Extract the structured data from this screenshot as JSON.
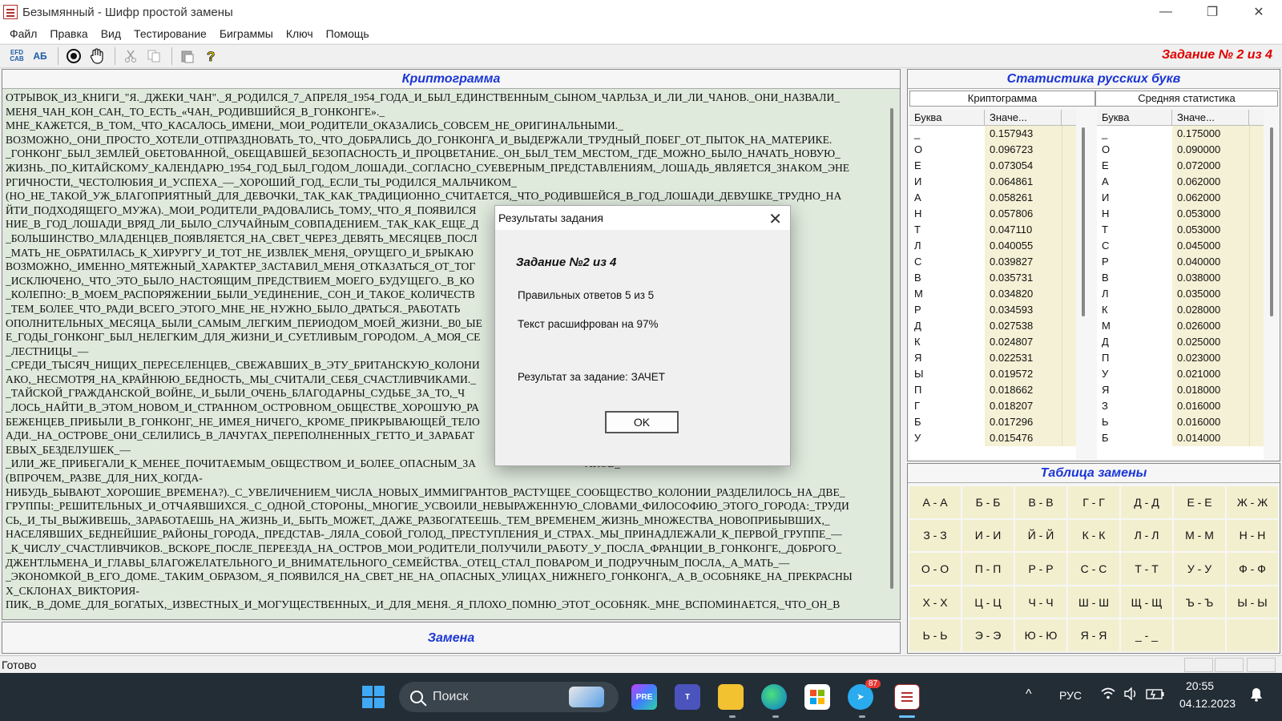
{
  "window": {
    "title": "Безымянный - Шифр простой замены",
    "controls": [
      "—",
      "❐",
      "✕"
    ]
  },
  "menu": [
    "Файл",
    "Правка",
    "Вид",
    "Тестирование",
    "Биграммы",
    "Ключ",
    "Помощь"
  ],
  "toolbar": {
    "buttons": [
      "EFD CAB",
      "АБ"
    ],
    "task_label": "Задание № 2 из 4"
  },
  "cryptogram": {
    "title": "Криптограмма",
    "lines": [
      "ОТРЫВОК_ИЗ_КНИГИ_\"Я._ДЖЕКИ_ЧАН\"._Я_РОДИЛСЯ_7_АПРЕЛЯ_1954_ГОДА_И_БЫЛ_ЕДИНСТВЕННЫМ_СЫНОМ_ЧАРЛЬЗА_И_ЛИ_ЛИ_ЧАНОВ._ОНИ_НАЗВАЛИ_",
      "МЕНЯ_ЧАН_КОН_САН,_ТО_ЕСТЬ_«ЧАН,_РОДИВШИЙСЯ_В_ГОНКОНГЕ»._",
      "МНЕ_КАЖЕТСЯ,_В_ТОМ,_ЧТО_КАСАЛОСЬ_ИМЕНИ,_МОИ_РОДИТЕЛИ_ОКАЗАЛИСЬ_СОВСЕМ_НЕ_ОРИГИНАЛЬНЫМИ._",
      "ВОЗМОЖНО,_ОНИ_ПРОСТО_ХОТЕЛИ_ОТПРАЗДНОВАТЬ_ТО,_ЧТО_ДОБРАЛИСЬ_ДО_ГОНКОНГА_И_ВЫДЕРЖАЛИ_ТРУДНЫЙ_ПОБЕГ_ОТ_ПЫТОК_НА_МАТЕРИКЕ.",
      "_ГОНКОНГ_БЫЛ_ЗЕМЛЕЙ_ОБЕТОВАННОЙ,_ОБЕЩАВШЕЙ_БЕЗОПАСНОСТЬ_И_ПРОЦВЕТАНИЕ._ОН_БЫЛ_ТЕМ_МЕСТОМ,_ГДЕ_МОЖНО_БЫЛО_НАЧАТЬ_НОВУЮ_",
      "ЖИЗНЬ._ПО_КИТАЙСКОМУ_КАЛЕНДАРЮ_1954_ГОД_БЫЛ_ГОДОМ_ЛОШАДИ._СОГЛАСНО_СУЕВЕРНЫМ_ПРЕДСТАВЛЕНИЯМ,_ЛОШАДЬ_ЯВЛЯЕТСЯ_ЗНАКОМ_ЭНЕ",
      "РГИЧНОСТИ,_ЧЕСТОЛЮБИЯ_И_УСПЕХА_—_ХОРОШИЙ_ГОД,_ЕСЛИ_ТЫ_РОДИЛСЯ_МАЛЬЧИКОМ_",
      "(НО_НЕ_ТАКОЙ_УЖ_БЛАГОПРИЯТНЫЙ_ДЛЯ_ДЕВОЧКИ,_ТАК_КАК_ТРАДИЦИОННО_СЧИТАЕТСЯ,_ЧТО_РОДИВШЕЙСЯ_В_ГОД_ЛОШАДИ_ДЕВУШКЕ_ТРУДНО_НА",
      "ЙТИ_ПОДХОДЯЩЕГО_МУЖА)._МОИ_РОДИТЕЛИ_РАДОВАЛИСЬ_ТОМУ,_ЧТО_Я_ПОЯВИЛСЯ                                           СТВЕННЫ._РОЖДЕ",
      "НИЕ_В_ГОД_ЛОШАДИ_ВРЯД_ЛИ_БЫЛО_СЛУЧАЙНЫМ_СОВПАДЕНИЕМ._ТАК_КАК_ЕЩЕ_Д                                                 РЯМЫМ!",
      "_БОЛЬШИНСТВО_МЛАДЕНЦЕВ_ПОЯВЛЯЕТСЯ_НА_СВЕТ_ЧЕРЕЗ_ДЕВЯТЬ_МЕСЯЦЕВ_ПОСЛ                                           ДОЛЬШЕ,_ПОКА",
      "_МАТЬ_НЕ_ОБРАТИЛАСЬ_К_ХИРУРГУ_И_ТОТ_НЕ_ИЗВЛЕК_МЕНЯ,_ОРУЩЕГО_И_БРЫКАЮ                                              ",
      "ВОЗМОЖНО,_ИМЕННО_МЯТЕЖНЫЙ_ХАРАКТЕР_ЗАСТАВИЛ_МЕНЯ_ОТКАЗАТЬСЯ_ОТ_ТОГ                                           ЛЯМ,_ХОТЯ_НЕ",
      "_ИСКЛЮЧЕНО,_ЧТО_ЭТО_БЫЛО_НАСТОЯЩИМ_ПРЕДСТВИЕМ_МОЕГО_БУДУЩЕГО._В_КО                                          СЕБЯ_ВЕЛИ-",
      "_КОЛЕПНО:_В_МОЕМ_РАСПОРЯЖЕНИИ_БЫЛИ_УЕДИНЕНИЕ,_СОН_И_ТАКОЕ_КОЛИЧЕСТВ                                          Я._—",
      "_ТЕМ_БОЛЕЕ_ЧТО_РАДИ_ВСЕГО_ЭТОГО_МНЕ_НЕ_НУЖНО_БЫЛО_ДРАТЬСЯ._РАБОТАТЬ                                          ЧТО_ТЕ_ТРИ_Д",
      "ОПОЛНИТЕЛЬНЫХ_МЕСЯЦА_БЫЛИ_САМЫМ_ЛЕГКИМ_ПЕРИОДОМ_МОЕЙ_ЖИЗНИ._В0_ЫЕ                                          БНОГО._В_50-",
      "Е_ГОДЫ_ГОНКОНГ_БЫЛ_НЕЛЕГКИМ_ДЛЯ_ЖИЗНИ_И_СУЕТЛИВЫМ_ГОРОДОМ._А_МОЯ_СЕ                                         ОБЩЕСТВЕННОЙ",
      "_ЛЕСТНИЦЫ_—",
      "_СРЕДИ_ТЫСЯЧ_НИЩИХ_ПЕРЕСЕЛЕНЦЕВ,_СВЕЖАВШИХ_В_ЭТУ_БРИТАНСКУЮ_КОЛОНИ                                          МАТЕРИКЕ._ОДН",
      "АКО,_НЕСМОТРЯ_НА_КРАЙНЮЮ_БЕДНОСТЬ,_МЫ_СЧИТАЛИ_СЕБЯ_СЧАСТЛИВЧИКАМИ._                                        ",
      "_ТАЙСКОЙ_ГРАЖДАНСКОЙ_ВОЙНЕ,_И_БЫЛИ_ОЧЕНЬ_БЛАГОДАРНЫ_СУДЬБЕ_ЗА_ТО,_Ч                                       ",
      "_ЛОСЬ_НАЙТИ_В_ЭТОМ_НОВОМ_И_СТРАННОМ_ОСТРОВНОМ_ОБЩЕСТВЕ_ХОРОШУЮ_РА                                        ",
      "БЕЖЕНЦЕВ_ПРИБЫЛИ_В_ГОНКОНГ,_НЕ_ИМЕЯ_НИЧЕГО,_КРОМЕ_ПРИКРЫВАЮЩЕЙ_ТЕЛО                                       ОСТАВИЛИ_ПОЗ",
      "АДИ._НА_ОСТРОВЕ_ОНИ_СЕЛИЛИСЬ_В_ЛАЧУГАХ_ПЕРЕПОЛНЕННЫХ_ГЕТТО_И_ЗАРАБАТ                                       ЦВЕТОВ_И_ДЕШ",
      "ЕВЫХ_БЕЗДЕЛУШЕК_—",
      "_ИЛИ_ЖЕ_ПРИБЕГАЛИ_К_МЕНЕЕ_ПОЧИТАЕМЫМ_ОБЩЕСТВОМ_И_БОЛЕЕ_ОПАСНЫМ_ЗА                                        АКОВ_",
      "(ВПРОЧЕМ,_РАЗВЕ_ДЛЯ_НИХ_КОГДА-",
      "НИБУДЬ_БЫВАЮТ_ХОРОШИЕ_ВРЕМЕНА?)._С_УВЕЛИЧЕНИЕМ_ЧИСЛА_НОВЫХ_ИММИГРАНТОВ_РАСТУЩЕЕ_СООБЩЕСТВО_КОЛОНИИ_РАЗДЕЛИЛОСЬ_НА_ДВЕ_",
      "ГРУППЫ:_РЕШИТЕЛЬНЫХ_И_ОТЧАЯВШИХСЯ._С_ОДНОЙ_СТОРОНЫ,_МНОГИЕ_УСВОИЛИ_НЕВЫРАЖЕННУЮ_СЛОВАМИ_ФИЛОСОФИЮ_ЭТОГО_ГОРОДА:_ТРУДИ",
      "СЬ,_И_ТЫ_ВЫЖИВЕШЬ,_ЗАРАБОТАЕШЬ_НА_ЖИЗНЬ_И,_БЫТЬ_МОЖЕТ,_ДАЖЕ_РАЗБОГАТЕЕШЬ._ТЕМ_ВРЕМЕНЕМ_ЖИЗНЬ_МНОЖЕСТВА_НОВОПРИБЫВШИХ,_",
      "НАСЕЛЯВШИХ_БЕДНЕЙШИЕ_РАЙОНЫ_ГОРОДА,_ПРЕДСТАВ-_ЛЯЛА_СОБОЙ_ГОЛОД,_ПРЕСТУПЛЕНИЯ_И_СТРАХ._МЫ_ПРИНАДЛЕЖАЛИ_К_ПЕРВОЙ_ГРУППЕ_—",
      "_К_ЧИСЛУ_СЧАСТЛИВЧИКОВ._ВСКОРЕ_ПОСЛЕ_ПЕРЕЕЗДА_НА_ОСТРОВ_МОИ_РОДИТЕЛИ_ПОЛУЧИЛИ_РАБОТУ_У_ПОСЛА_ФРАНЦИИ_В_ГОНКОНГЕ,_ДОБРОГО_",
      "ДЖЕНТЛЬМЕНА_И_ГЛАВЫ_БЛАГОЖЕЛАТЕЛЬНОГО_И_ВНИМАТЕЛЬНОГО_СЕМЕЙСТВА._ОТЕЦ_СТАЛ_ПОВАРОМ_И_ПОДРУЧНЫМ_ПОСЛА,_А_МАТЬ_—",
      "_ЭКОНОМКОЙ_В_ЕГО_ДОМЕ._ТАКИМ_ОБРАЗОМ,_Я_ПОЯВИЛСЯ_НА_СВЕТ_НЕ_НА_ОПАСНЫХ_УЛИЦАХ_НИЖНЕГО_ГОНКОНГА,_А_В_ОСОБНЯКЕ_НА_ПРЕКРАСНЫ",
      "Х_СКЛОНАХ_ВИКТОРИЯ-",
      "ПИК,_В_ДОМЕ_ДЛЯ_БОГАТЫХ,_ИЗВЕСТНЫХ_И_МОГУЩЕСТВЕННЫХ,_И_ДЛЯ_МЕНЯ._Я_ПЛОХО_ПОМНЮ_ЭТОТ_ОСОБНЯК._МНЕ_ВСПОМИНАЕТСЯ,_ЧТО_ОН_В"
    ]
  },
  "zamena": {
    "title": "Замена"
  },
  "stats": {
    "title": "Статистика русских букв",
    "crypto_header": "Криптограмма",
    "avg_header": "Средняя статистика",
    "col_letter": "Буква",
    "col_value": "Значе...",
    "crypto_rows": [
      [
        "_",
        "0.157943"
      ],
      [
        "О",
        "0.096723"
      ],
      [
        "Е",
        "0.073054"
      ],
      [
        "И",
        "0.064861"
      ],
      [
        "А",
        "0.058261"
      ],
      [
        "Н",
        "0.057806"
      ],
      [
        "Т",
        "0.047110"
      ],
      [
        "Л",
        "0.040055"
      ],
      [
        "С",
        "0.039827"
      ],
      [
        "В",
        "0.035731"
      ],
      [
        "М",
        "0.034820"
      ],
      [
        "Р",
        "0.034593"
      ],
      [
        "Д",
        "0.027538"
      ],
      [
        "К",
        "0.024807"
      ],
      [
        "Я",
        "0.022531"
      ],
      [
        "Ы",
        "0.019572"
      ],
      [
        "П",
        "0.018662"
      ],
      [
        "Г",
        "0.018207"
      ],
      [
        "Б",
        "0.017296"
      ],
      [
        "У",
        "0.015476"
      ]
    ],
    "avg_rows": [
      [
        "_",
        "0.175000"
      ],
      [
        "О",
        "0.090000"
      ],
      [
        "Е",
        "0.072000"
      ],
      [
        "А",
        "0.062000"
      ],
      [
        "И",
        "0.062000"
      ],
      [
        "Н",
        "0.053000"
      ],
      [
        "Т",
        "0.053000"
      ],
      [
        "С",
        "0.045000"
      ],
      [
        "Р",
        "0.040000"
      ],
      [
        "В",
        "0.038000"
      ],
      [
        "Л",
        "0.035000"
      ],
      [
        "К",
        "0.028000"
      ],
      [
        "М",
        "0.026000"
      ],
      [
        "Д",
        "0.025000"
      ],
      [
        "П",
        "0.023000"
      ],
      [
        "У",
        "0.021000"
      ],
      [
        "Я",
        "0.018000"
      ],
      [
        "З",
        "0.016000"
      ],
      [
        "Ь",
        "0.016000"
      ],
      [
        "Б",
        "0.014000"
      ]
    ]
  },
  "substitution": {
    "title": "Таблица замены",
    "cells": [
      "А - А",
      "Б - Б",
      "В - В",
      "Г - Г",
      "Д - Д",
      "Е - Е",
      "Ж - Ж",
      "З - З",
      "И - И",
      "Й - Й",
      "К - К",
      "Л - Л",
      "М - М",
      "Н - Н",
      "О - О",
      "П - П",
      "Р - Р",
      "С - С",
      "Т - Т",
      "У - У",
      "Ф - Ф",
      "Х - Х",
      "Ц - Ц",
      "Ч - Ч",
      "Ш - Ш",
      "Щ - Щ",
      "Ъ - Ъ",
      "Ы - Ы",
      "Ь - Ь",
      "Э - Э",
      "Ю - Ю",
      "Я - Я",
      "_ - _",
      "",
      ""
    ]
  },
  "status": {
    "text": "Готово"
  },
  "dialog": {
    "title": "Результаты задания",
    "heading": "Задание №2 из 4",
    "correct": "Правильных ответов 5 из 5",
    "decoded": "Текст расшифрован на 97%",
    "result": "Результат за задание: ЗАЧЕТ",
    "ok": "OK"
  },
  "taskbar": {
    "search_placeholder": "Поиск",
    "lang": "РУС",
    "time": "20:55",
    "date": "04.12.2023",
    "telegram_badge": "87"
  }
}
